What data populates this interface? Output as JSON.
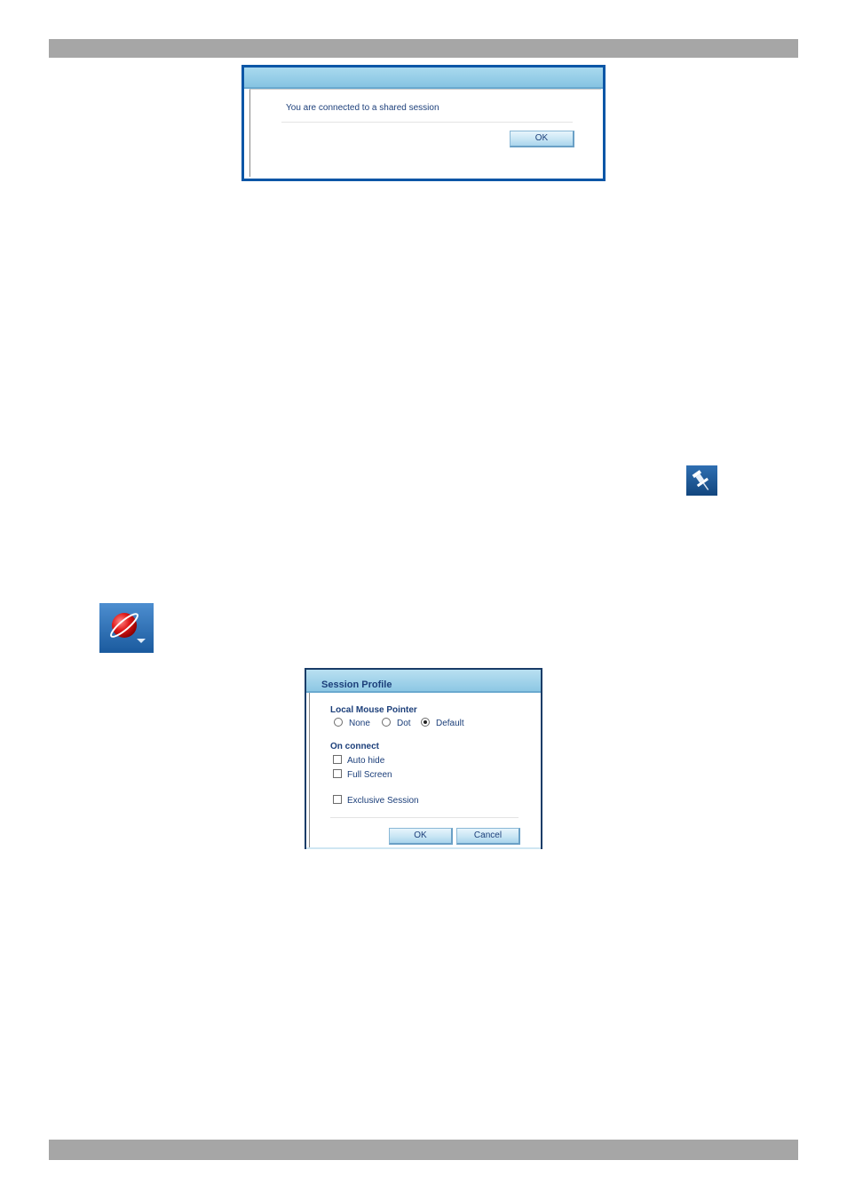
{
  "shared_dialog": {
    "message": "You are connected to a shared session",
    "ok_label": "OK"
  },
  "icons": {
    "pin": "pin-icon",
    "globe": "globe-menu-icon"
  },
  "session_profile": {
    "title": "Session Profile",
    "mouse_section": "Local Mouse Pointer",
    "mouse_options": [
      {
        "label": "None",
        "selected": false
      },
      {
        "label": "Dot",
        "selected": false
      },
      {
        "label": "Default",
        "selected": true
      }
    ],
    "connect_section": "On connect",
    "auto_hide": {
      "label": "Auto hide",
      "checked": false
    },
    "full_screen": {
      "label": "Full Screen",
      "checked": false
    },
    "exclusive": {
      "label": "Exclusive Session",
      "checked": false
    },
    "ok_label": "OK",
    "cancel_label": "Cancel"
  },
  "colors": {
    "page_bar": "#a6a6a6",
    "dialog_border": "#0b56a6",
    "title_bar": "#86c4e2",
    "text": "#1c3f7a"
  }
}
